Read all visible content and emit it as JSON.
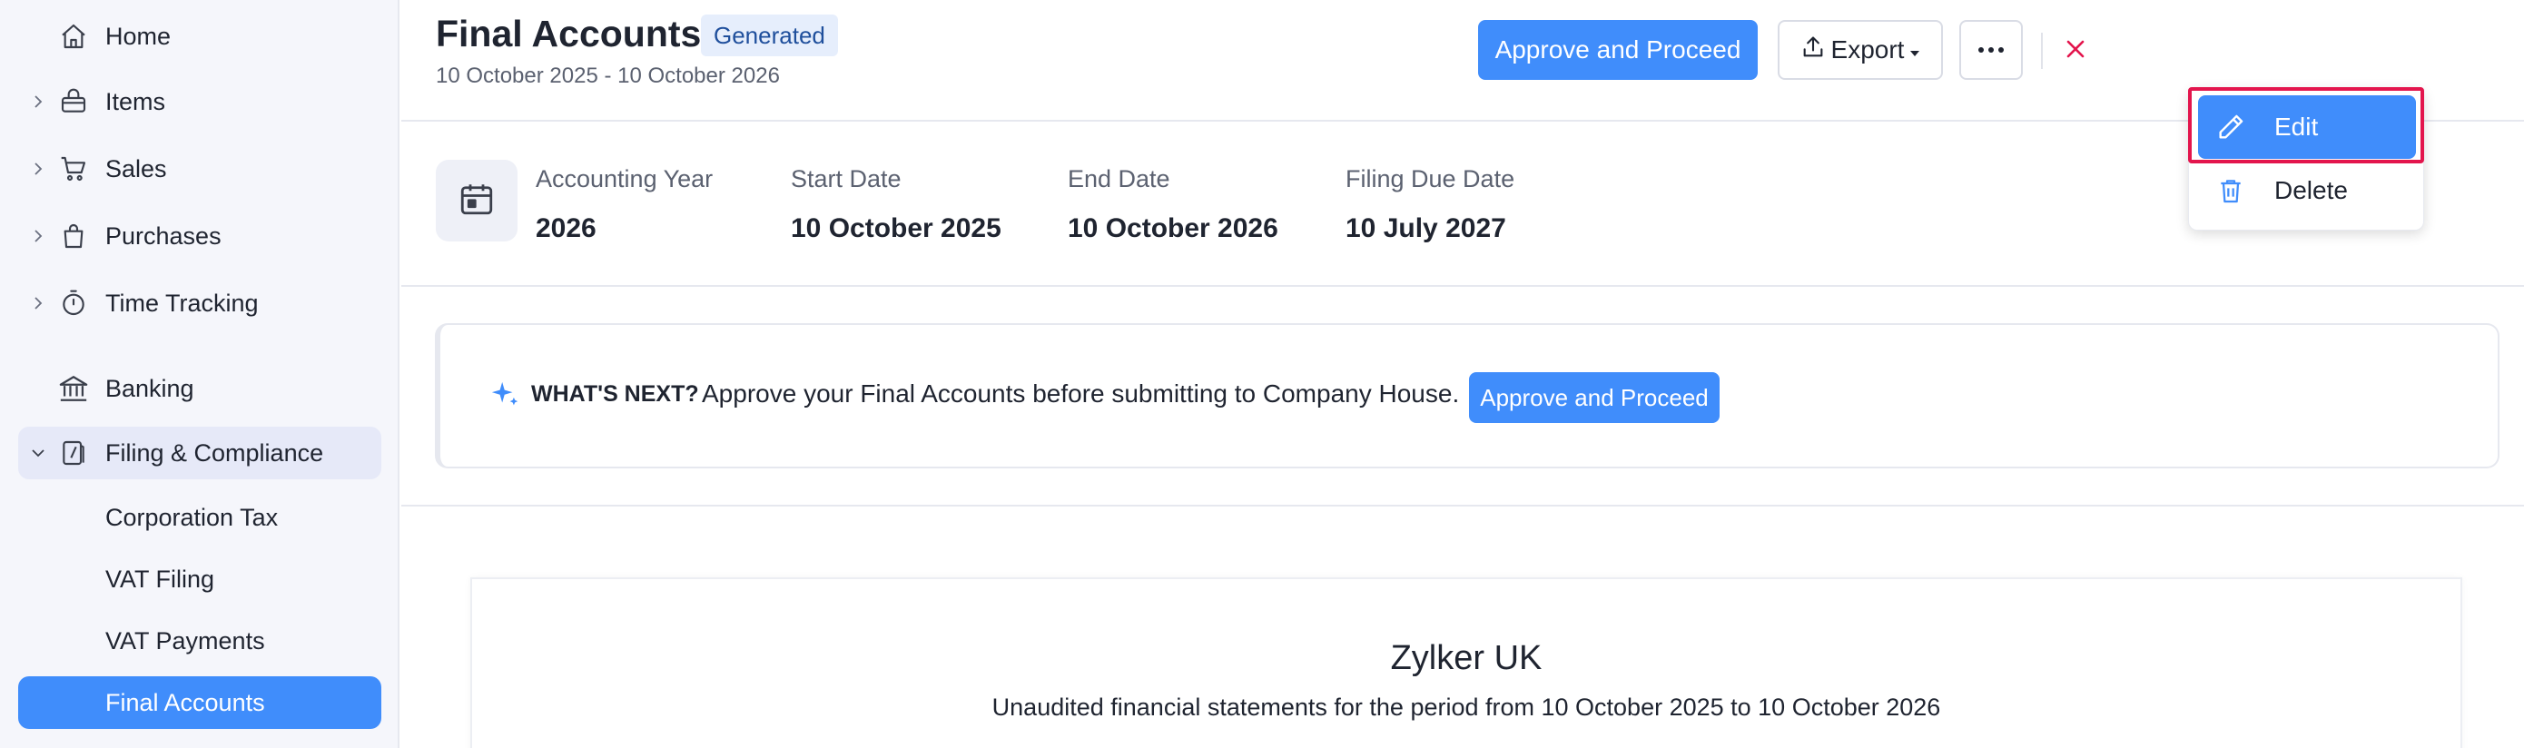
{
  "sidebar": {
    "items": [
      {
        "label": "Home",
        "icon": "home-icon"
      },
      {
        "label": "Items",
        "icon": "basket-icon"
      },
      {
        "label": "Sales",
        "icon": "cart-icon"
      },
      {
        "label": "Purchases",
        "icon": "bag-icon"
      },
      {
        "label": "Time Tracking",
        "icon": "stopwatch-icon"
      },
      {
        "label": "Banking",
        "icon": "bank-icon"
      },
      {
        "label": "Filing & Compliance",
        "icon": "document-icon"
      }
    ],
    "sub_items": [
      {
        "label": "Corporation Tax"
      },
      {
        "label": "VAT Filing"
      },
      {
        "label": "VAT Payments"
      },
      {
        "label": "Final Accounts"
      }
    ],
    "selected": "Final Accounts"
  },
  "header": {
    "title": "Final Accounts",
    "status_badge": "Generated",
    "period": "10 October 2025 - 10 October 2026",
    "approve_label": "Approve and Proceed",
    "export_label": "Export",
    "more_icon": "ellipsis-icon",
    "close_icon": "close-icon"
  },
  "info": {
    "fields": [
      {
        "label": "Accounting Year",
        "value": "2026"
      },
      {
        "label": "Start Date",
        "value": "10 October 2025"
      },
      {
        "label": "End Date",
        "value": "10 October 2026"
      },
      {
        "label": "Filing Due Date",
        "value": "10 July 2027"
      }
    ]
  },
  "banner": {
    "heading": "WHAT'S NEXT?",
    "message": "Approve your Final Accounts before submitting to Company House.",
    "button_label": "Approve and Proceed"
  },
  "report": {
    "organization": "Zylker UK",
    "description": "Unaudited financial statements for the period from 10 October 2025 to 10 October 2026"
  },
  "dropdown": {
    "items": [
      {
        "label": "Edit",
        "icon": "pencil-icon"
      },
      {
        "label": "Delete",
        "icon": "trash-icon"
      }
    ]
  },
  "colors": {
    "primary": "#408dfb",
    "highlight_border": "#e3154d",
    "close": "#e3154d",
    "badge_bg": "#e6eefc",
    "sidebar_bg": "#f5f6fb"
  }
}
